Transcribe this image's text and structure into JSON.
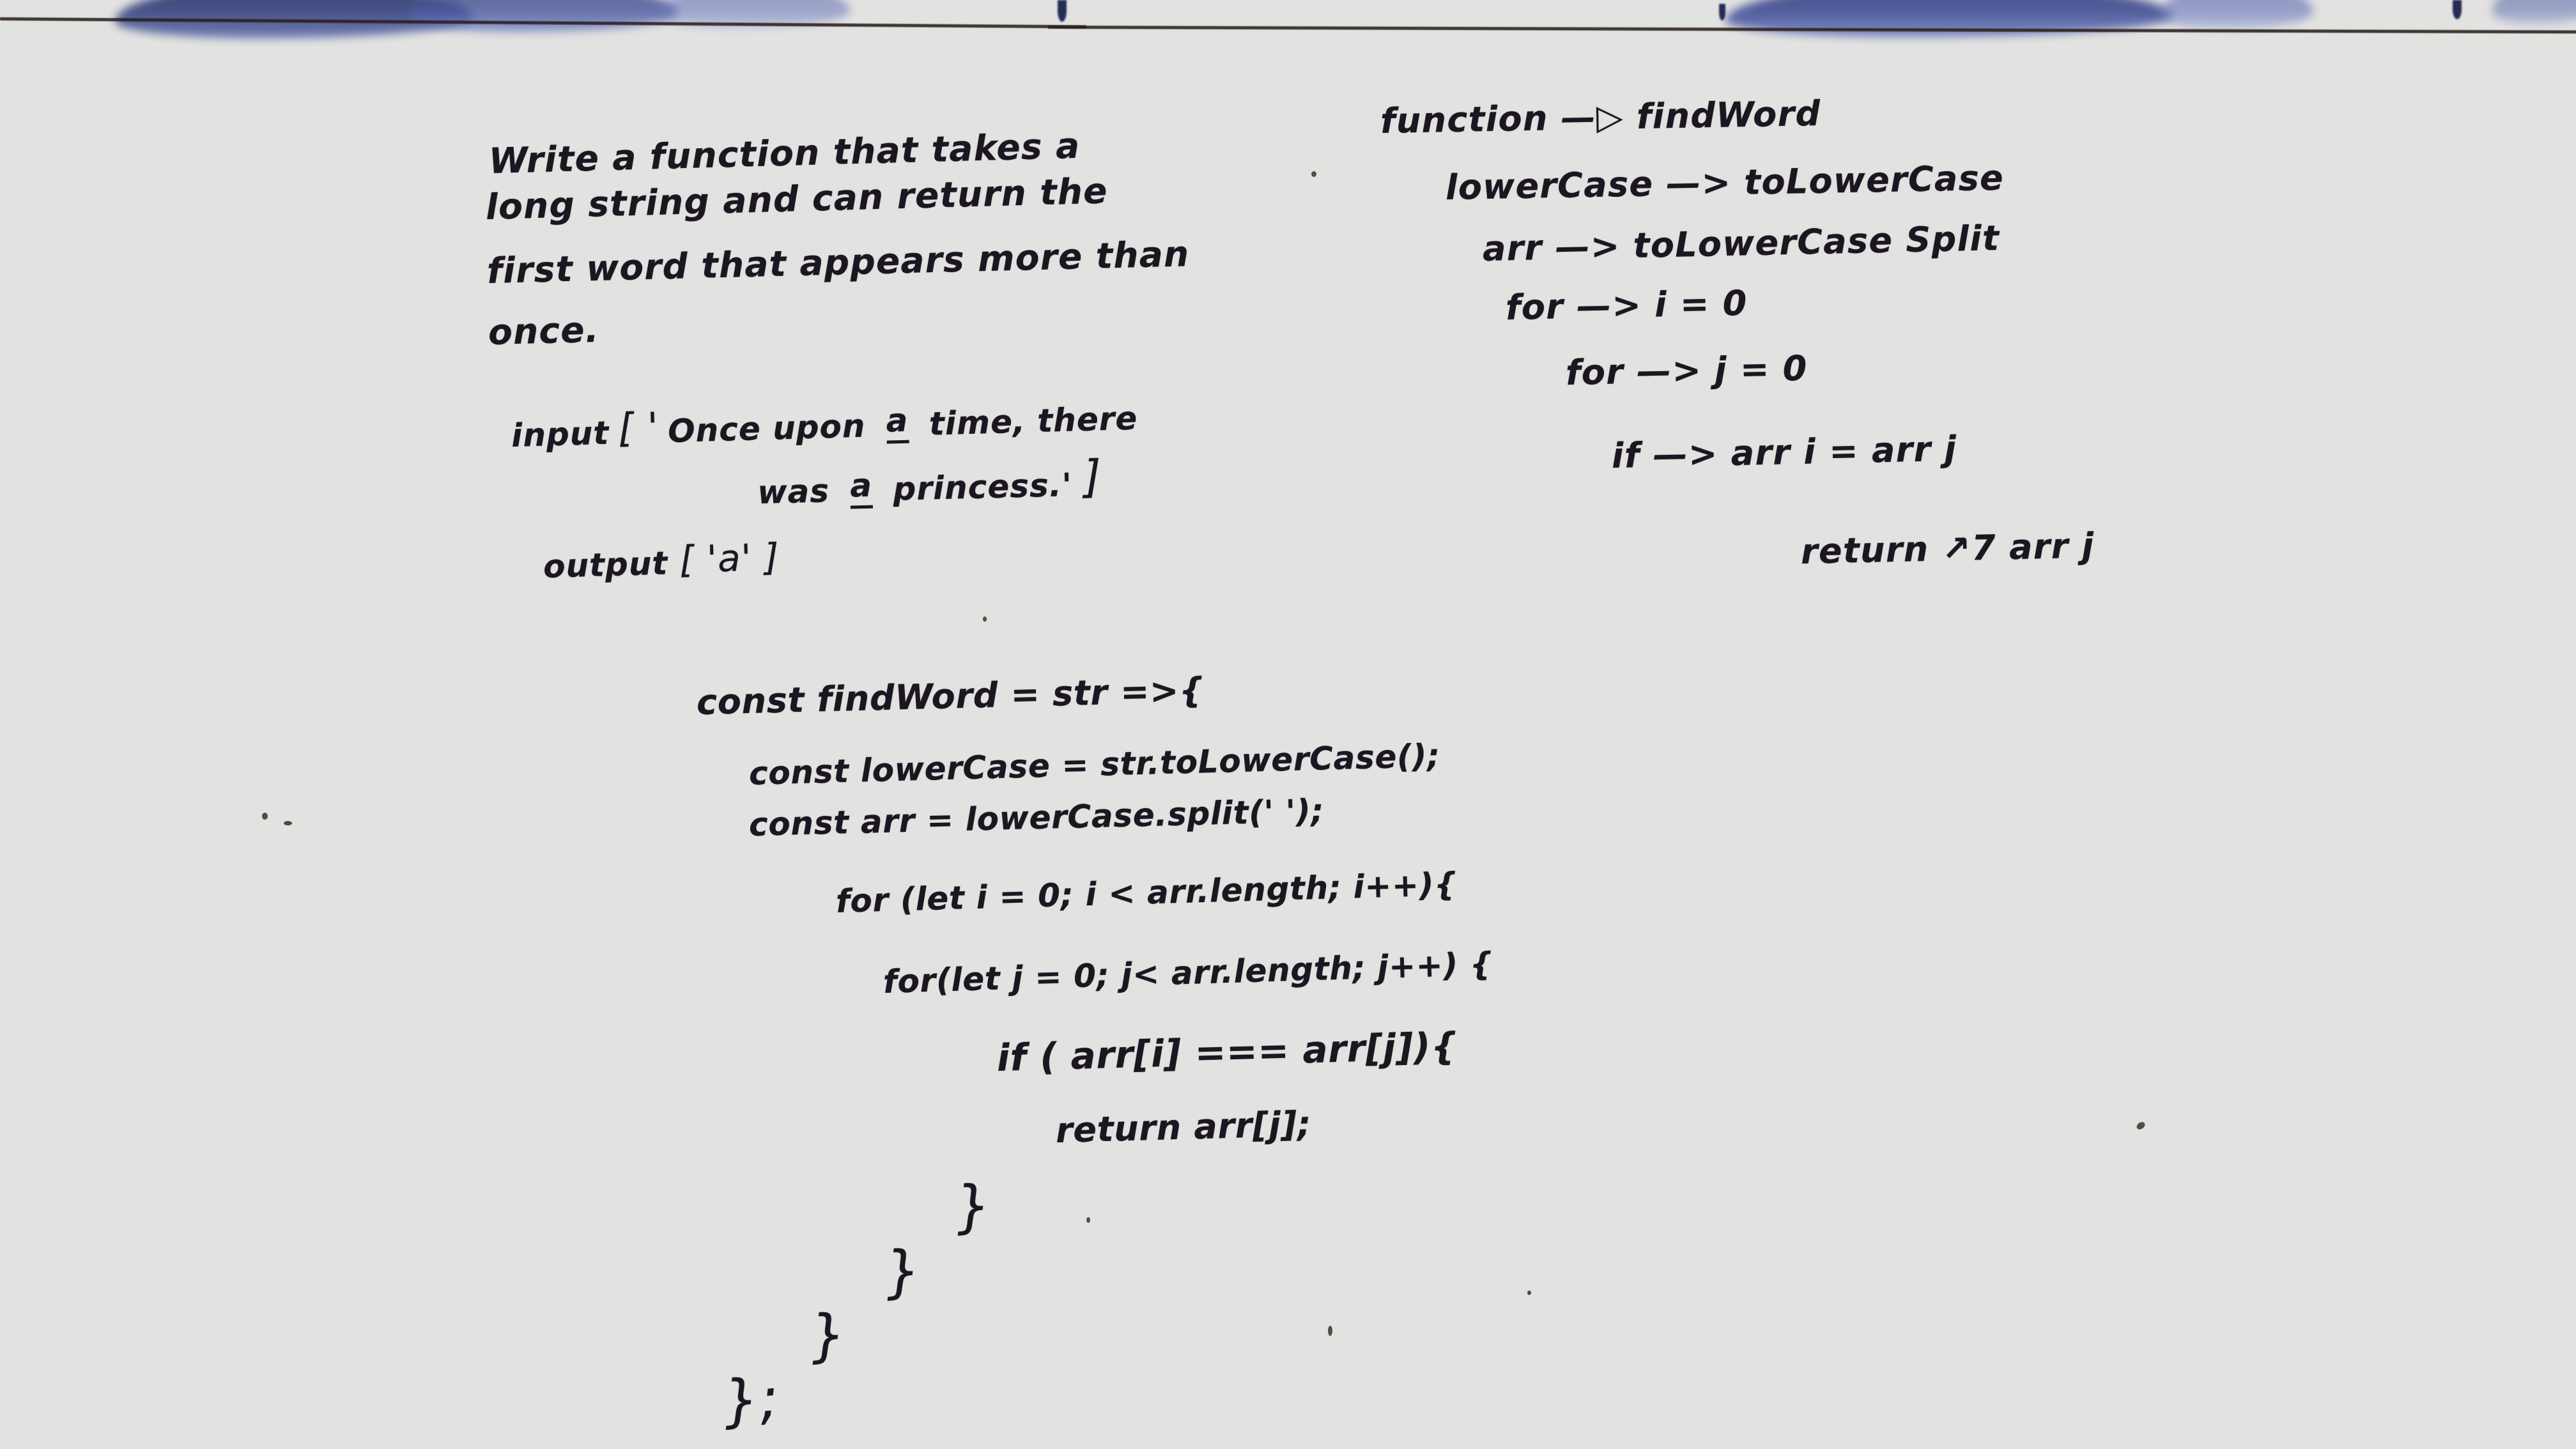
{
  "board": {
    "background_color": "#e2e2e1",
    "ink_color": "#1b1620",
    "smudge_color": "#3d4a86",
    "rule_line_color": "#2a1f1c"
  },
  "prompt": {
    "lines": [
      "Write a function that takes a",
      "long string and can return the",
      "first word that appears more than",
      "once."
    ]
  },
  "example": {
    "input_label": "input",
    "input_open": "[ '",
    "input_text_line1_a": "Once upon ",
    "input_underlined_1": "a",
    "input_text_line1_b": " time, there",
    "input_text_line2_a": "was ",
    "input_underlined_2": "a",
    "input_text_line2_b": " princess.'",
    "input_close": "]",
    "output_label": "output",
    "output_value": "[ 'a' ]"
  },
  "pseudocode": {
    "lines": [
      "function —▷ findWord",
      "lowerCase —> toLowerCase",
      "arr —> toLowerCase Split",
      "for —> i = 0",
      "for —> j = 0",
      "if —> arr i = arr j",
      "return ↗7 arr j"
    ]
  },
  "code": {
    "lines": [
      "const findWord = str =>{",
      "const lowerCase = str.toLowerCase();",
      "const arr = lowerCase.split(' ');",
      "for (let i = 0; i < arr.length; i++){",
      "for(let j = 0; j< arr.length; j++) {",
      "if ( arr[i] === arr[j]){",
      "return arr[j];"
    ],
    "closing_braces": [
      "}",
      "}",
      "}",
      "};"
    ]
  }
}
